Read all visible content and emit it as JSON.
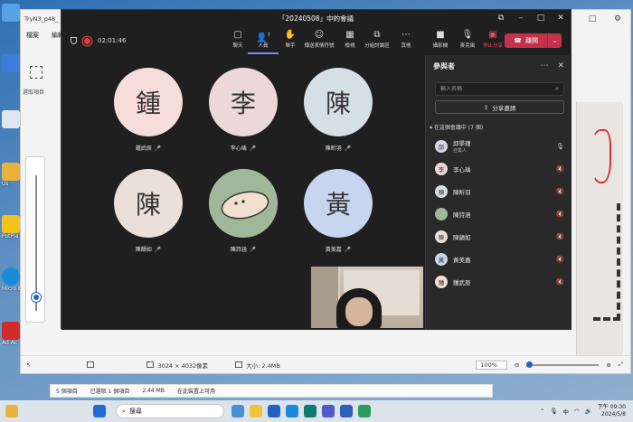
{
  "desktop": {
    "icons": [
      {
        "label": "",
        "color": "#5aa0e6",
        "icon": "computer-icon"
      },
      {
        "label": "",
        "color": "#3b7dd8",
        "icon": "app-icon"
      },
      {
        "label": "",
        "color": "#e0e6ee",
        "icon": "recycle-icon"
      },
      {
        "label": "Us",
        "color": "#e8b33a",
        "icon": "folder-icon"
      },
      {
        "label": "PotPla",
        "color": "#f3c21b",
        "icon": "potplayer-icon"
      },
      {
        "label": "Micro Edg",
        "color": "#1a8bd8",
        "icon": "edge-icon"
      },
      {
        "label": "Ad Ac",
        "color": "#d32a2a",
        "icon": "acrobat-icon"
      }
    ]
  },
  "photos": {
    "title": "TryN3_p48_",
    "menu": [
      "檔案",
      "編輯"
    ],
    "select_label": "選取項目",
    "status": {
      "dimensions": "3024 × 4032像素",
      "size": "大小: 2.4MB",
      "zoom": "100%"
    }
  },
  "explorer": {
    "count": "5 個項目",
    "selected": "已選取 1 個項目",
    "selected_size": "2.44 MB",
    "location": "在此裝置上可用"
  },
  "teams": {
    "title": "「20240508」中的會議",
    "timer": "02:01:46",
    "toolbar": [
      {
        "label": "聊天",
        "glyph": "▢",
        "icon": "chat-icon"
      },
      {
        "label": "人員",
        "glyph": "👥",
        "icon": "people-icon",
        "badge": "7"
      },
      {
        "label": "舉手",
        "glyph": "✋",
        "icon": "raise-hand-icon"
      },
      {
        "label": "傳送表情符號",
        "glyph": "☺",
        "icon": "emoji-icon"
      },
      {
        "label": "檢視",
        "glyph": "▦",
        "icon": "view-icon"
      },
      {
        "label": "分組討論區",
        "glyph": "⧉",
        "icon": "breakout-icon"
      },
      {
        "label": "其他",
        "glyph": "⋯",
        "icon": "more-icon"
      },
      {
        "label": "攝影機",
        "glyph": "■",
        "icon": "camera-icon"
      },
      {
        "label": "麥克風",
        "glyph": "🎤",
        "icon": "microphone-icon"
      },
      {
        "label": "停止分享",
        "glyph": "▣",
        "icon": "stop-share-icon"
      }
    ],
    "leave_label": "離開",
    "tiles": [
      {
        "char": "鍾",
        "name": "鍾武辰",
        "color": "#f6ddd9"
      },
      {
        "char": "李",
        "name": "李心瑀",
        "color": "#ecd7db"
      },
      {
        "char": "陳",
        "name": "陳昕羽",
        "color": "#d5dfe6"
      },
      {
        "char": "陳",
        "name": "陳韻如",
        "color": "#eadfd9"
      },
      {
        "char": "",
        "name": "陳詩涵",
        "color": "#9fb89a"
      },
      {
        "char": "黃",
        "name": "黃美嘉",
        "color": "#c7d6ee"
      }
    ],
    "panel": {
      "title": "參與者",
      "search_placeholder": "輸入名稱",
      "share_invite": "分享邀請",
      "section": "在這個會議中 (7 個)",
      "participants": [
        {
          "char": "邱",
          "name": "邱學瑾",
          "role": "召集人",
          "color": "#d8d5e8",
          "mic": "🎤"
        },
        {
          "char": "李",
          "name": "李心瑀",
          "role": "",
          "color": "#ecd7db",
          "mic": "🔇"
        },
        {
          "char": "陳",
          "name": "陳昕羽",
          "role": "",
          "color": "#d5dfe6",
          "mic": "🔇"
        },
        {
          "char": "",
          "name": "陳詩涵",
          "role": "",
          "color": "#9fb89a",
          "mic": "🔇"
        },
        {
          "char": "陳",
          "name": "陳韻如",
          "role": "",
          "color": "#eadfd9",
          "mic": "🔇"
        },
        {
          "char": "黃",
          "name": "黃美嘉",
          "role": "",
          "color": "#c7d6ee",
          "mic": "🔇"
        },
        {
          "char": "鍾",
          "name": "鍾武辰",
          "role": "",
          "color": "#f6ddd9",
          "mic": "🔇"
        }
      ]
    }
  },
  "taskbar": {
    "search": "搜尋",
    "time": "下午 09:30",
    "date": "2024/5/8",
    "lang": "中"
  }
}
